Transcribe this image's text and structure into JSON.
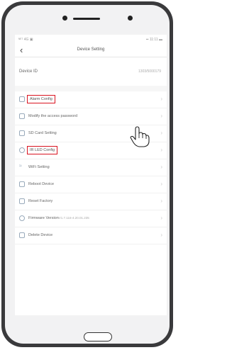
{
  "status": {
    "left": "ᴺᴱᵀ 4G ▣",
    "right": "▪▪ 11:11 ▬"
  },
  "nav": {
    "title": "Device Setting"
  },
  "device_id": {
    "label": "Device ID",
    "value": "1303/5000179"
  },
  "menu": {
    "items": [
      {
        "label": "Alarm Config",
        "icon": "bell-icon"
      },
      {
        "label": "Modify the access password",
        "icon": "lock-icon"
      },
      {
        "label": "SD Card Setting",
        "icon": "sd-card-icon"
      },
      {
        "label": "IR LED Config",
        "icon": "ir-led-icon"
      },
      {
        "label": "WiFi Setting",
        "icon": "wifi-icon"
      },
      {
        "label": "Reboot Device",
        "icon": "reboot-icon"
      },
      {
        "label": "Reset Factory",
        "icon": "reset-icon"
      },
      {
        "label": "Firmware Version",
        "value": "V1.7.116-4.20.01.235",
        "icon": "firmware-icon"
      },
      {
        "label": "Delete Device",
        "icon": "trash-icon"
      }
    ]
  },
  "colors": {
    "highlight": "#d9121f",
    "frame": "#3a3a3c"
  }
}
